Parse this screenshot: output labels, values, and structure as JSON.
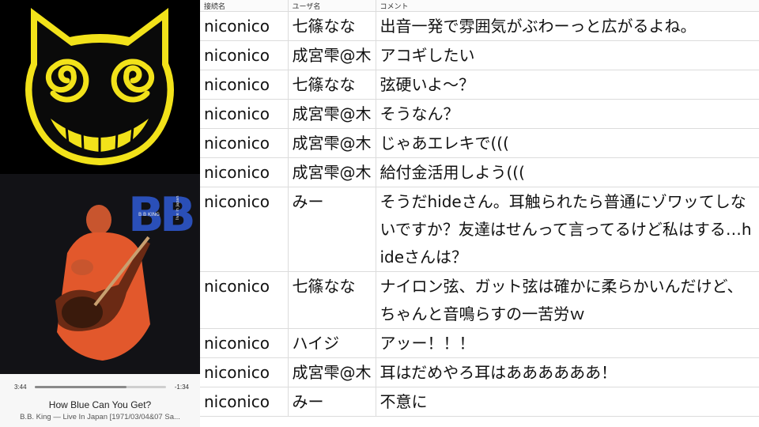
{
  "player": {
    "elapsed": "3:44",
    "remaining": "-1:34",
    "progress_fraction": 0.7,
    "track_title": "How Blue Can You Get?",
    "track_subtitle": "B.B. King — Live In Japan [1971/03/04&07 Sa..."
  },
  "album": {
    "art_text_bb": "B B KING",
    "art_text_live": "live in Japan"
  },
  "table": {
    "headers": [
      "接続名",
      "ユーザ名",
      "コメント"
    ],
    "rows": [
      {
        "source": "niconico",
        "user": "七篠なな",
        "comment": "出音一発で雰囲気がぶわーっと広がるよね。"
      },
      {
        "source": "niconico",
        "user": "成宮雫@木",
        "comment": "アコギしたい"
      },
      {
        "source": "niconico",
        "user": "七篠なな",
        "comment": "弦硬いよ～？"
      },
      {
        "source": "niconico",
        "user": "成宮雫@木",
        "comment": "そうなん？"
      },
      {
        "source": "niconico",
        "user": "成宮雫@木",
        "comment": "じゃあエレキで((("
      },
      {
        "source": "niconico",
        "user": "成宮雫@木",
        "comment": "給付金活用しよう((("
      },
      {
        "source": "niconico",
        "user": "みー",
        "comment": "そうだhideさん。耳触られたら普通にゾワッてしないですか？友達はせんって言ってるけど私はする…hideさんは？"
      },
      {
        "source": "niconico",
        "user": "七篠なな",
        "comment": "ナイロン弦、ガット弦は確かに柔らかいんだけど、ちゃんと音鳴らすの一苦労ｗ"
      },
      {
        "source": "niconico",
        "user": "ハイジ",
        "comment": "アッー！！！"
      },
      {
        "source": "niconico",
        "user": "成宮雫@木",
        "comment": "耳はだめやろ耳はああああああ！"
      },
      {
        "source": "niconico",
        "user": "みー",
        "comment": "不意に"
      }
    ]
  },
  "colors": {
    "logo_yellow": "#f2e21a",
    "album_orange": "#e2582c",
    "album_blue": "#2a4fb8"
  }
}
